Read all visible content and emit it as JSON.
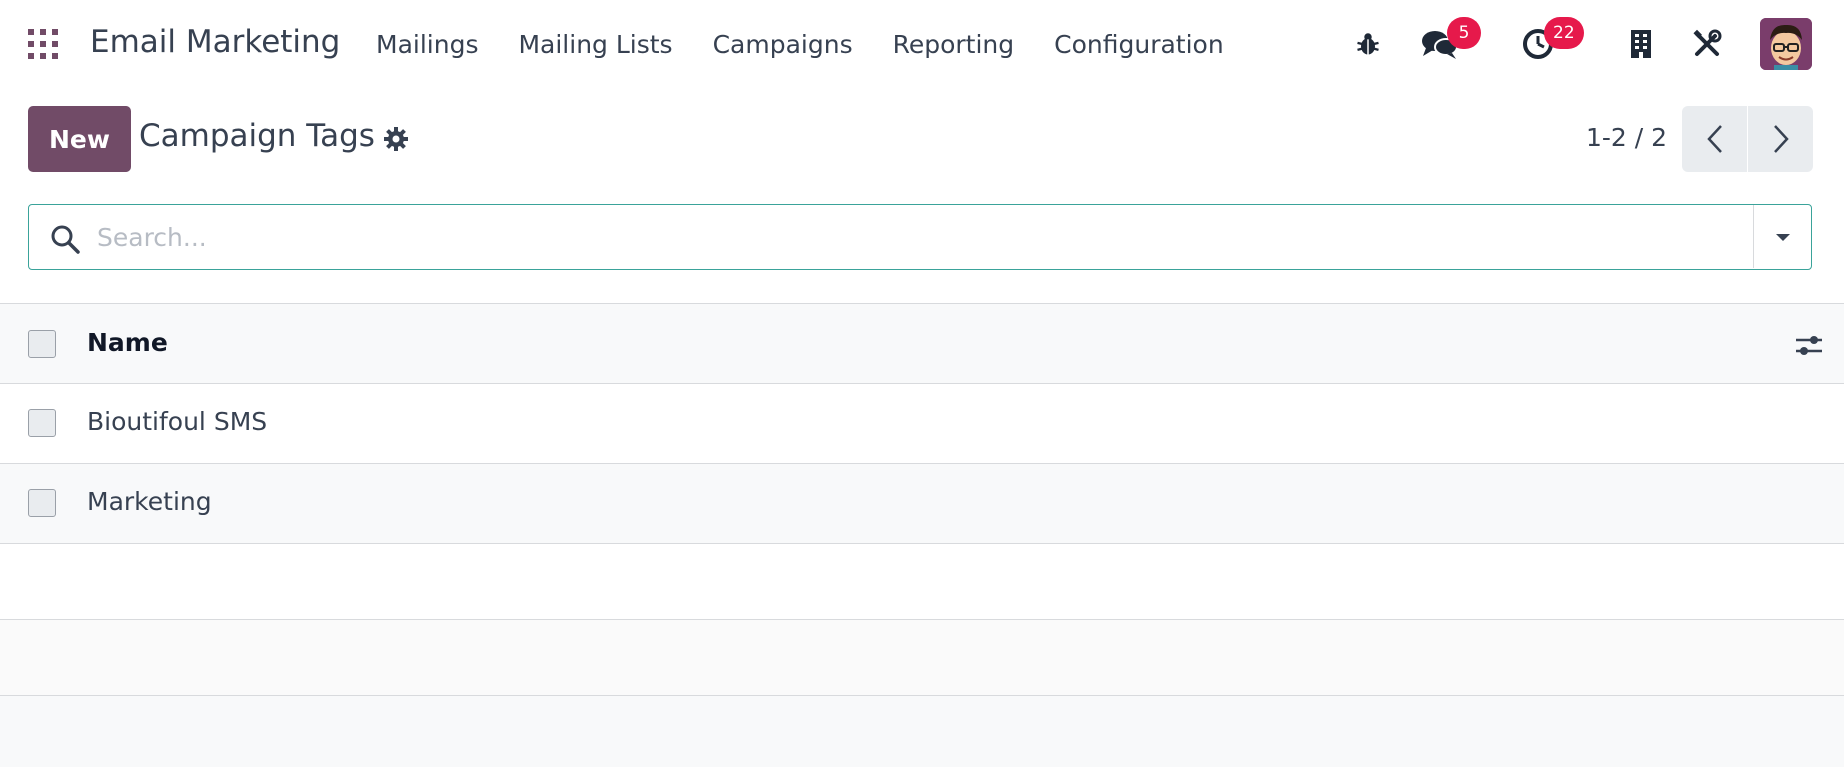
{
  "navbar": {
    "brand": "Email Marketing",
    "menu": [
      "Mailings",
      "Mailing Lists",
      "Campaigns",
      "Reporting",
      "Configuration"
    ],
    "messages_badge": "5",
    "activities_badge": "22"
  },
  "control_panel": {
    "new_label": "New",
    "title": "Campaign Tags",
    "pager": "1-2 / 2"
  },
  "search": {
    "placeholder": "Search..."
  },
  "list": {
    "columns": [
      "Name"
    ],
    "rows": [
      "Bioutifoul SMS",
      "Marketing"
    ]
  },
  "colors": {
    "brand": "#714B67",
    "badge": "#e6194b",
    "search_focus": "#3aa39a"
  }
}
